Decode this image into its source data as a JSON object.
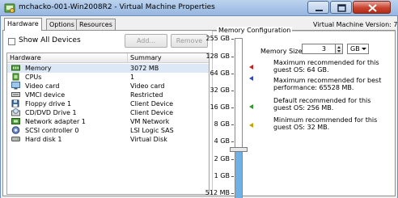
{
  "window": {
    "title": "mchacko-001-Win2008R2 - Virtual Machine Properties"
  },
  "tabs": [
    {
      "label": "Hardware",
      "active": true
    },
    {
      "label": "Options",
      "active": false
    },
    {
      "label": "Resources",
      "active": false
    }
  ],
  "vm_version": "Virtual Machine Version: 7",
  "left": {
    "show_all_label": "Show All Devices",
    "show_all_checked": false,
    "add_label": "Add...",
    "remove_label": "Remove",
    "columns": [
      "Hardware",
      "Summary"
    ],
    "rows": [
      {
        "icon": "memory-icon",
        "name": "Memory",
        "summary": "3072 MB",
        "selected": true
      },
      {
        "icon": "cpu-icon",
        "name": "CPUs",
        "summary": "1",
        "selected": false
      },
      {
        "icon": "video-card-icon",
        "name": "Video card",
        "summary": "Video card",
        "selected": false
      },
      {
        "icon": "vmci-device-icon",
        "name": "VMCI device",
        "summary": "Restricted",
        "selected": false
      },
      {
        "icon": "floppy-drive-icon",
        "name": "Floppy drive 1",
        "summary": "Client Device",
        "selected": false
      },
      {
        "icon": "cd-dvd-drive-icon",
        "name": "CD/DVD Drive 1",
        "summary": "Client Device",
        "selected": false
      },
      {
        "icon": "network-adapter-icon",
        "name": "Network adapter 1",
        "summary": "VM Network",
        "selected": false
      },
      {
        "icon": "scsi-controller-icon",
        "name": "SCSI controller 0",
        "summary": "LSI Logic SAS",
        "selected": false
      },
      {
        "icon": "hard-disk-icon",
        "name": "Hard disk 1",
        "summary": "Virtual Disk",
        "selected": false
      }
    ]
  },
  "memory": {
    "group_label": "Memory Configuration",
    "size_label": "Memory Size:",
    "size_value": "3",
    "unit": "GB",
    "scale_labels": [
      "255 GB",
      "128 GB",
      "64 GB",
      "32 GB",
      "16 GB",
      "8 GB",
      "4 GB",
      "2 GB",
      "1 GB",
      "512 MB"
    ],
    "slider_value_gb": 3,
    "legend": [
      {
        "marker": "red",
        "line1": "Maximum recommended for this",
        "line2": "guest OS: 64 GB."
      },
      {
        "marker": "blue",
        "line1": "Maximum recommended for best",
        "line2": "performance: 65528 MB."
      },
      {
        "marker": "green",
        "line1": "Default recommended for this",
        "line2": "guest OS: 256 MB."
      },
      {
        "marker": "yellow",
        "line1": "Minimum recommended for this",
        "line2": "guest OS: 32 MB."
      }
    ],
    "colors": {
      "max_marker": "#cc2020",
      "best_marker": "#2b47c8",
      "default_marker": "#2c9a2c",
      "min_marker": "#c8a400",
      "slider_fill": "#6fb1e6"
    }
  }
}
